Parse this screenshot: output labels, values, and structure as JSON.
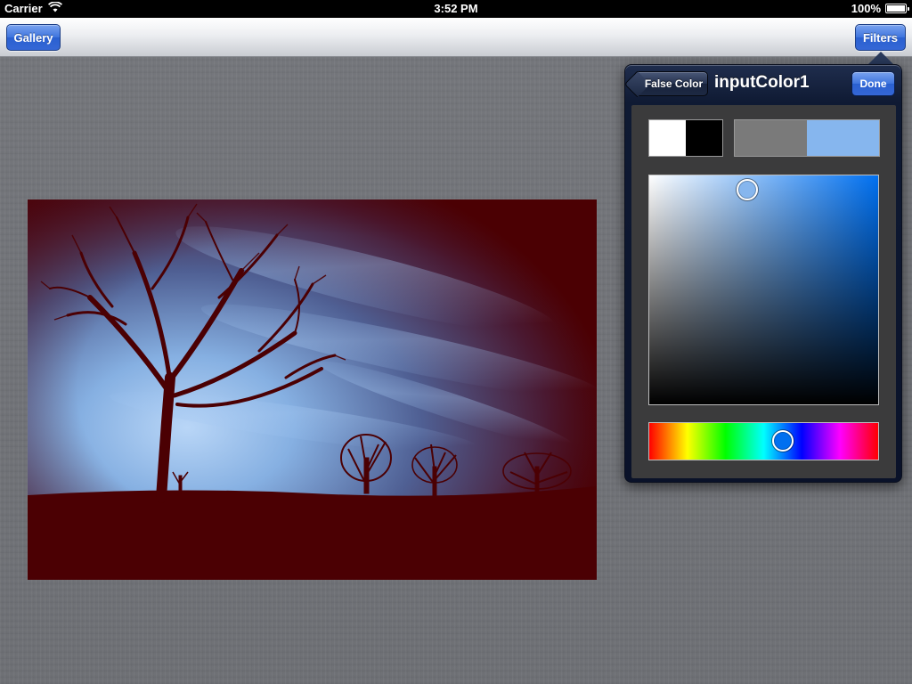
{
  "status_bar": {
    "carrier": "Carrier",
    "time": "3:52 PM",
    "battery": "100%"
  },
  "toolbar": {
    "gallery_label": "Gallery",
    "filters_label": "Filters"
  },
  "popover": {
    "back_label": "False Color",
    "title": "inputColor1",
    "done_label": "Done",
    "swatches": {
      "input_colors": [
        "#ffffff",
        "#000000"
      ],
      "comparison_colors": [
        "#7a7a7a",
        "#86b6ee"
      ]
    },
    "color_picker": {
      "hue_color": "#0070f0",
      "selected_color": "#86b6ee",
      "saturation": 0.43,
      "brightness": 0.94,
      "hue_fraction": 0.58
    }
  },
  "colors": {
    "accent": "#3567d6",
    "photo_tint": "#4b0003",
    "sky_blue": "#86b6ee"
  },
  "icons": {
    "wifi": "wifi-icon",
    "battery": "battery-icon"
  }
}
